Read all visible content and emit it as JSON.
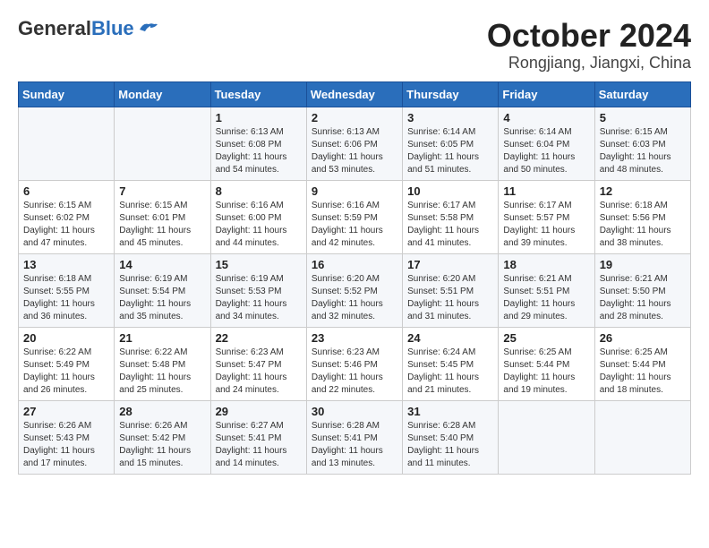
{
  "header": {
    "logo_general": "General",
    "logo_blue": "Blue",
    "month_title": "October 2024",
    "location": "Rongjiang, Jiangxi, China"
  },
  "weekdays": [
    "Sunday",
    "Monday",
    "Tuesday",
    "Wednesday",
    "Thursday",
    "Friday",
    "Saturday"
  ],
  "weeks": [
    [
      {
        "day": "",
        "info": ""
      },
      {
        "day": "",
        "info": ""
      },
      {
        "day": "1",
        "info": "Sunrise: 6:13 AM\nSunset: 6:08 PM\nDaylight: 11 hours and 54 minutes."
      },
      {
        "day": "2",
        "info": "Sunrise: 6:13 AM\nSunset: 6:06 PM\nDaylight: 11 hours and 53 minutes."
      },
      {
        "day": "3",
        "info": "Sunrise: 6:14 AM\nSunset: 6:05 PM\nDaylight: 11 hours and 51 minutes."
      },
      {
        "day": "4",
        "info": "Sunrise: 6:14 AM\nSunset: 6:04 PM\nDaylight: 11 hours and 50 minutes."
      },
      {
        "day": "5",
        "info": "Sunrise: 6:15 AM\nSunset: 6:03 PM\nDaylight: 11 hours and 48 minutes."
      }
    ],
    [
      {
        "day": "6",
        "info": "Sunrise: 6:15 AM\nSunset: 6:02 PM\nDaylight: 11 hours and 47 minutes."
      },
      {
        "day": "7",
        "info": "Sunrise: 6:15 AM\nSunset: 6:01 PM\nDaylight: 11 hours and 45 minutes."
      },
      {
        "day": "8",
        "info": "Sunrise: 6:16 AM\nSunset: 6:00 PM\nDaylight: 11 hours and 44 minutes."
      },
      {
        "day": "9",
        "info": "Sunrise: 6:16 AM\nSunset: 5:59 PM\nDaylight: 11 hours and 42 minutes."
      },
      {
        "day": "10",
        "info": "Sunrise: 6:17 AM\nSunset: 5:58 PM\nDaylight: 11 hours and 41 minutes."
      },
      {
        "day": "11",
        "info": "Sunrise: 6:17 AM\nSunset: 5:57 PM\nDaylight: 11 hours and 39 minutes."
      },
      {
        "day": "12",
        "info": "Sunrise: 6:18 AM\nSunset: 5:56 PM\nDaylight: 11 hours and 38 minutes."
      }
    ],
    [
      {
        "day": "13",
        "info": "Sunrise: 6:18 AM\nSunset: 5:55 PM\nDaylight: 11 hours and 36 minutes."
      },
      {
        "day": "14",
        "info": "Sunrise: 6:19 AM\nSunset: 5:54 PM\nDaylight: 11 hours and 35 minutes."
      },
      {
        "day": "15",
        "info": "Sunrise: 6:19 AM\nSunset: 5:53 PM\nDaylight: 11 hours and 34 minutes."
      },
      {
        "day": "16",
        "info": "Sunrise: 6:20 AM\nSunset: 5:52 PM\nDaylight: 11 hours and 32 minutes."
      },
      {
        "day": "17",
        "info": "Sunrise: 6:20 AM\nSunset: 5:51 PM\nDaylight: 11 hours and 31 minutes."
      },
      {
        "day": "18",
        "info": "Sunrise: 6:21 AM\nSunset: 5:51 PM\nDaylight: 11 hours and 29 minutes."
      },
      {
        "day": "19",
        "info": "Sunrise: 6:21 AM\nSunset: 5:50 PM\nDaylight: 11 hours and 28 minutes."
      }
    ],
    [
      {
        "day": "20",
        "info": "Sunrise: 6:22 AM\nSunset: 5:49 PM\nDaylight: 11 hours and 26 minutes."
      },
      {
        "day": "21",
        "info": "Sunrise: 6:22 AM\nSunset: 5:48 PM\nDaylight: 11 hours and 25 minutes."
      },
      {
        "day": "22",
        "info": "Sunrise: 6:23 AM\nSunset: 5:47 PM\nDaylight: 11 hours and 24 minutes."
      },
      {
        "day": "23",
        "info": "Sunrise: 6:23 AM\nSunset: 5:46 PM\nDaylight: 11 hours and 22 minutes."
      },
      {
        "day": "24",
        "info": "Sunrise: 6:24 AM\nSunset: 5:45 PM\nDaylight: 11 hours and 21 minutes."
      },
      {
        "day": "25",
        "info": "Sunrise: 6:25 AM\nSunset: 5:44 PM\nDaylight: 11 hours and 19 minutes."
      },
      {
        "day": "26",
        "info": "Sunrise: 6:25 AM\nSunset: 5:44 PM\nDaylight: 11 hours and 18 minutes."
      }
    ],
    [
      {
        "day": "27",
        "info": "Sunrise: 6:26 AM\nSunset: 5:43 PM\nDaylight: 11 hours and 17 minutes."
      },
      {
        "day": "28",
        "info": "Sunrise: 6:26 AM\nSunset: 5:42 PM\nDaylight: 11 hours and 15 minutes."
      },
      {
        "day": "29",
        "info": "Sunrise: 6:27 AM\nSunset: 5:41 PM\nDaylight: 11 hours and 14 minutes."
      },
      {
        "day": "30",
        "info": "Sunrise: 6:28 AM\nSunset: 5:41 PM\nDaylight: 11 hours and 13 minutes."
      },
      {
        "day": "31",
        "info": "Sunrise: 6:28 AM\nSunset: 5:40 PM\nDaylight: 11 hours and 11 minutes."
      },
      {
        "day": "",
        "info": ""
      },
      {
        "day": "",
        "info": ""
      }
    ]
  ]
}
